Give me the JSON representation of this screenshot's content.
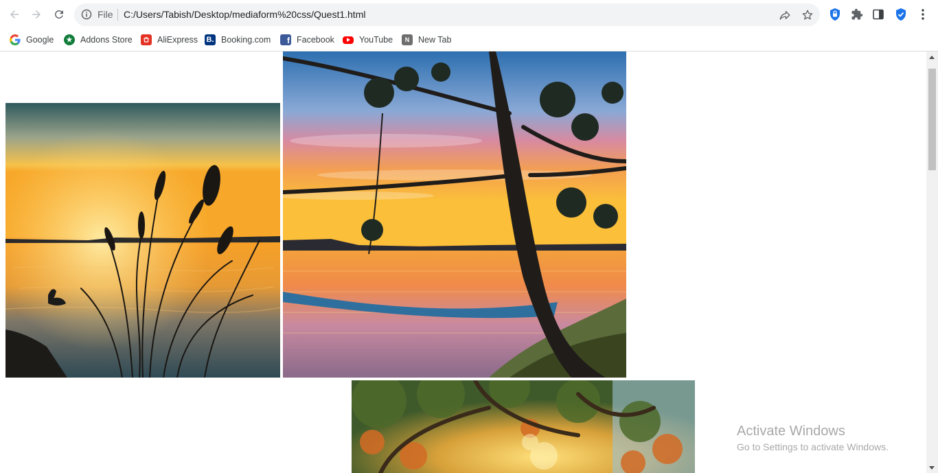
{
  "browser": {
    "scheme_label": "File",
    "url": "C:/Users/Tabish/Desktop/mediaform%20css/Quest1.html"
  },
  "bookmarks": [
    {
      "label": "Google",
      "icon": "google-icon"
    },
    {
      "label": "Addons Store",
      "icon": "addons-store-icon"
    },
    {
      "label": "AliExpress",
      "icon": "aliexpress-icon"
    },
    {
      "label": "Booking.com",
      "icon": "booking-icon"
    },
    {
      "label": "Facebook",
      "icon": "facebook-icon"
    },
    {
      "label": "YouTube",
      "icon": "youtube-icon"
    },
    {
      "label": "New Tab",
      "icon": "new-tab-icon"
    }
  ],
  "photos": [
    {
      "name": "lake-reeds-sunset-image",
      "subject": "sunset over lake with reeds and duck"
    },
    {
      "name": "lake-hammock-sunset-image",
      "subject": "pine tree with hammock at lake sunset"
    },
    {
      "name": "autumn-forest-image",
      "subject": "sunlit autumn forest canopy"
    }
  ],
  "watermark": {
    "title": "Activate Windows",
    "subtitle": "Go to Settings to activate Windows."
  },
  "colors": {
    "accent": "#1a73e8",
    "omnibox_bg": "#f1f3f4"
  }
}
